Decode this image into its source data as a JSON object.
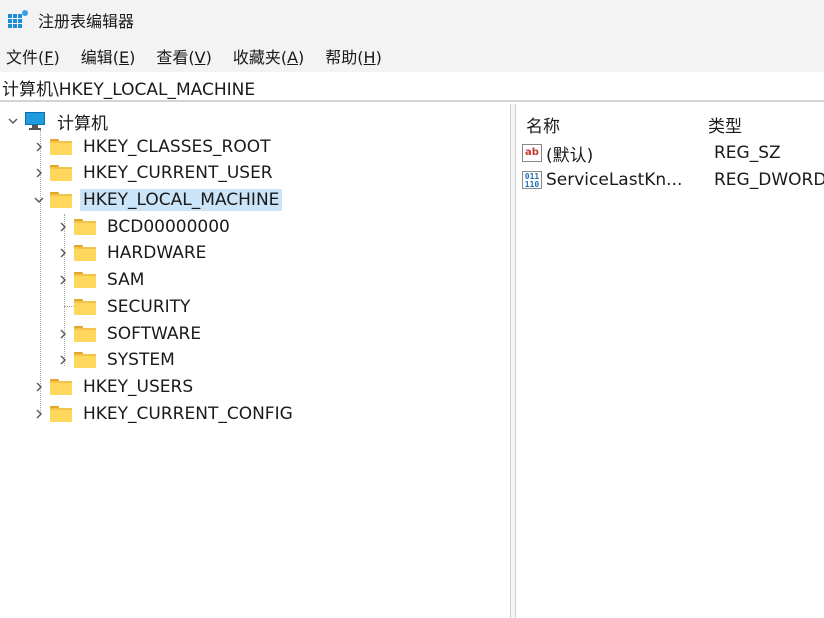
{
  "window": {
    "title": "注册表编辑器"
  },
  "menu": [
    {
      "label": "文件",
      "accel": "F"
    },
    {
      "label": "编辑",
      "accel": "E"
    },
    {
      "label": "查看",
      "accel": "V"
    },
    {
      "label": "收藏夹",
      "accel": "A"
    },
    {
      "label": "帮助",
      "accel": "H"
    }
  ],
  "address": "计算机\\HKEY_LOCAL_MACHINE",
  "tree": {
    "root": "计算机",
    "nodes": [
      {
        "label": "HKEY_CLASSES_ROOT",
        "expanded": false
      },
      {
        "label": "HKEY_CURRENT_USER",
        "expanded": false
      },
      {
        "label": "HKEY_LOCAL_MACHINE",
        "expanded": true,
        "selected": true
      },
      {
        "label": "BCD00000000"
      },
      {
        "label": "HARDWARE"
      },
      {
        "label": "SAM"
      },
      {
        "label": "SECURITY"
      },
      {
        "label": "SOFTWARE"
      },
      {
        "label": "SYSTEM"
      },
      {
        "label": "HKEY_USERS",
        "expanded": false
      },
      {
        "label": "HKEY_CURRENT_CONFIG",
        "expanded": false
      }
    ]
  },
  "list": {
    "columns": {
      "name": "名称",
      "type": "类型"
    },
    "rows": [
      {
        "name": "(默认)",
        "type": "REG_SZ",
        "icon": "string-value-icon"
      },
      {
        "name": "ServiceLastKn...",
        "type": "REG_DWORD",
        "icon": "binary-value-icon"
      }
    ]
  }
}
